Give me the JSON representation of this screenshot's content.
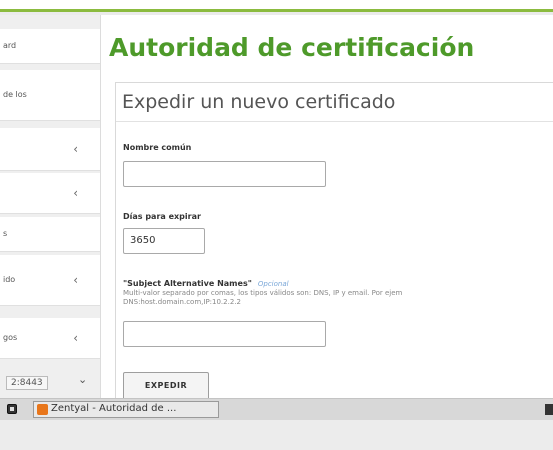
{
  "sidebar": {
    "items": [
      {
        "label": "ard",
        "chevron": ""
      },
      {
        "label": "de los",
        "chevron": ""
      },
      {
        "label": "",
        "chevron": "‹"
      },
      {
        "label": "",
        "chevron": "‹"
      },
      {
        "label": "s",
        "chevron": ""
      },
      {
        "label": "ido",
        "chevron": "‹"
      },
      {
        "label": "gos",
        "chevron": "‹"
      }
    ],
    "address_value": "2:8443",
    "address_chevron": "⌄"
  },
  "main": {
    "page_title": "Autoridad de certificación",
    "panel_title": "Expedir un nuevo certificado",
    "form": {
      "common_name_label": "Nombre común",
      "common_name_value": "",
      "days_label": "Días para expirar",
      "days_value": "3650",
      "san_label": "\"Subject Alternative Names\"",
      "san_optional": "Opcional",
      "san_help_line1": "Multi-valor separado por comas, los tipos válidos son: DNS, IP y email. Por ejem",
      "san_help_line2": "DNS:host.domain.com,IP:10.2.2.2",
      "san_value": "",
      "submit_label": "EXPEDIR"
    }
  },
  "taskbar": {
    "task_label": "Zentyal - Autoridad de ..."
  },
  "colors": {
    "accent_green": "#4e9a2a",
    "top_border_green": "#8bbb3f",
    "optional_blue": "#7aa7d8"
  }
}
